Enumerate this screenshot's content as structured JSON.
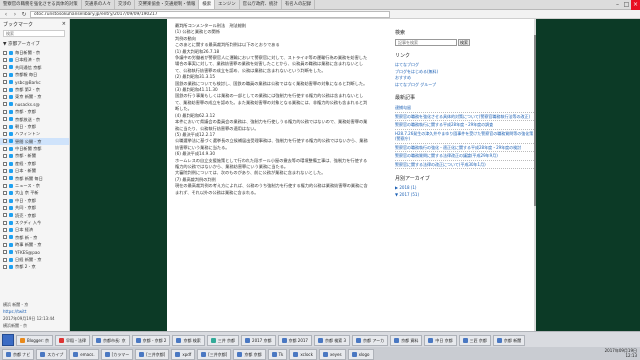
{
  "tabs": [
    {
      "label": "警察官の職務を強化させる具体的対策",
      "active": false
    },
    {
      "label": "交通系の人々",
      "active": false
    },
    {
      "label": "交渉の",
      "active": false
    },
    {
      "label": "交響楽協会・交通規制・情報",
      "active": false
    },
    {
      "label": "検索",
      "active": true
    },
    {
      "label": "エンジン",
      "active": false
    },
    {
      "label": "官公庁政府、統計",
      "active": false
    },
    {
      "label": "有名人の記録",
      "active": false
    }
  ],
  "address_bar": {
    "url": "otoc.runstosokuhanselibary.jp/entry/2017/09/09/190217"
  },
  "sidebar": {
    "title": "ブックマーク",
    "search_placeholder": "検索",
    "folder": "▼ 京都アーカイブ",
    "items": [
      {
        "label": "毎日新聞 - 京",
        "icon": "twitter-icon",
        "selected": false
      },
      {
        "label": "日本経済 - 京",
        "icon": "twitter-icon",
        "selected": false
      },
      {
        "label": "共同通信 京都",
        "icon": "twitter-icon",
        "selected": false
      },
      {
        "label": "京都報 毎日",
        "icon": "twitter-icon",
        "selected": false
      },
      {
        "label": "ysbc@Barkc",
        "icon": "twitter-icon",
        "selected": false
      },
      {
        "label": "京都 第2 - 京",
        "icon": "twitter-icon",
        "selected": false
      },
      {
        "label": "東京 新聞 - 京",
        "icon": "twitter-icon",
        "selected": false
      },
      {
        "label": "nusacks.s@",
        "icon": "twitter-icon",
        "selected": false
      },
      {
        "label": "京都 - 京都",
        "icon": "twitter-icon",
        "selected": false
      },
      {
        "label": "京都放送 - 京",
        "icon": "twitter-icon",
        "selected": false
      },
      {
        "label": "朝日 - 京都",
        "icon": "twitter-icon",
        "selected": false
      },
      {
        "label": "ハフィントン",
        "icon": "twitter-icon",
        "selected": false
      },
      {
        "label": "昼間 公開 - 京",
        "icon": "twitter-icon",
        "selected": true
      },
      {
        "label": "中日新聞 京都",
        "icon": "twitter-icon",
        "selected": false
      },
      {
        "label": "京都 - 新聞",
        "icon": "twitter-icon",
        "selected": false
      },
      {
        "label": "産経 - 京都",
        "icon": "twitter-icon",
        "selected": false
      },
      {
        "label": "日本 - 新聞",
        "icon": "twitter-icon",
        "selected": false
      },
      {
        "label": "京都 新聞 毎日",
        "icon": "twitter-icon",
        "selected": false
      },
      {
        "label": "ニュース - 京",
        "icon": "twitter-icon",
        "selected": false
      },
      {
        "label": "大山 京 平新",
        "icon": "twitter-icon",
        "selected": false
      },
      {
        "label": "中日 - 京都",
        "icon": "twitter-icon",
        "selected": false
      },
      {
        "label": "共同 - 京都",
        "icon": "twitter-icon",
        "selected": false
      },
      {
        "label": "読売 - 京都",
        "icon": "twitter-icon",
        "selected": false
      },
      {
        "label": "スクディ 入今",
        "icon": "twitter-icon",
        "selected": false
      },
      {
        "label": "日本 経済",
        "icon": "twitter-icon",
        "selected": false
      },
      {
        "label": "京都 新 - 京",
        "icon": "twitter-icon",
        "selected": false
      },
      {
        "label": "時事 新聞 - 京",
        "icon": "twitter-icon",
        "selected": false
      },
      {
        "label": "YFKES@pao",
        "icon": "twitter-icon",
        "selected": false
      },
      {
        "label": "日経 新聞 - 京",
        "icon": "twitter-icon",
        "selected": false
      },
      {
        "label": "京都 2 - 京",
        "icon": "twitter-icon",
        "selected": false
      }
    ],
    "footer": {
      "item1": "横浜 新聞 - 京",
      "link": "https://twitt",
      "timestamp": "2017年09月19日 12:13:44",
      "item2": "横浜新聞 - 京"
    }
  },
  "article": {
    "lines": [
      "最判所コンメンタール刑法　刑法総則",
      "(1) 公務と業務との関係",
      "判例の動向",
      "このあとに関する最高裁判所判例は以下のとおりである",
      "(1) 最大判昭和26.7.18",
      "争議中の労働者が警察官人に運輸において警察官に対して、ストライキ等の運輸行為の業務を妨害した場合の事実に対して、業務妨害罪の業務を妨害したことから、公務員の職務は業務に含まれないとして、公務執行妨害罪の成立を認め、公務は業務に含まれないという判断をした。",
      "(2) 最判昭和31.3.15",
      "国鉄の業務についても検討し、国鉄の職員の業務は公務ではなく業務妨害罪の対象になると判断した。",
      "(3) 最判昭和41.11.30",
      "国鉄の行う事業もしくは業務の一部としての業務には強制力を行使する権力的公務は含まれないとして、業務妨害罪の成立を認めた。また業務妨害罪の対象となる業務には、非権力的公務も含まれると判断した。",
      "(4) 最判昭和62.3.12",
      "本件において県議会の委員会の業務は、強制力を行使しうる権力的公務ではないので、業務妨害罪の業務に当たり、公務執行妨害罪の適用はない。",
      "(5) 最決平成12.2.17",
      "公職選挙法に基づく選挙長の立候補届出受理事務は、強制力を行使する権力的公務ではないから、業務妨害罪にいう業務に当たる。",
      "(6) 最決平成14.9.30",
      "ホームレスの自立支援施策として行われた段ボール小屋の撤去等の環境整備工事は、強制力を行使する権力的公務ではないから、業務妨害罪にいう業務に当たる。",
      "大審院判例については、次のものがあり、前に公務が業務に含まれないとした。",
      "(7) 最高裁判例の判例",
      "現在の最高裁判例の考え方によれば、公務のうち強制力を行使する権力的公務は業務妨害罪の業務に含まれず、それ以外の公務は業務に含まれる。"
    ]
  },
  "right_column": {
    "search_title": "検索",
    "search_placeholder": "記事を検索",
    "search_button": "検索",
    "links_title": "リンク",
    "links": [
      "はてなブログ",
      "ブログをはじめる(無料)",
      "おすすめ",
      "はてなブログ グループ"
    ],
    "recent_title": "最新記事",
    "recent": [
      "逮捕勾留",
      "警察官の職務を強化させる具体的対策について(警察官職務執行法等の改正)",
      "警察官の職務執行に関する平成28年度・29年度の調査",
      "H28.7.26発生の津久井やまゆり園事件を受けた警察官の職務質問等の強化策(警察庁)",
      "警察官の職務執行の強化・適正化に関する平成28年度・29年度の検討",
      "警察官の職務質問に関する法律改正の議論(平成29年9月)",
      "警察官に関する法律の改正について(平成30年1月)"
    ],
    "archive_title": "月別アーカイブ",
    "archive": [
      "▶ 2018 (1)",
      "▼ 2017 (51)"
    ]
  },
  "taskbar": {
    "row1": [
      {
        "label": "Blogger: 京",
        "icon": "orange"
      },
      {
        "label": "早稲・法律",
        "icon": "red"
      },
      {
        "label": "京都市長: 京",
        "icon": "blue"
      },
      {
        "label": "京都 - 京都 2",
        "icon": "blue"
      },
      {
        "label": "京都 検索",
        "icon": "blue"
      },
      {
        "label": "三井 京都",
        "icon": "green"
      },
      {
        "label": "2017 京都",
        "icon": "blue"
      },
      {
        "label": "京都 2017",
        "icon": "blue"
      },
      {
        "label": "京都 検索 3",
        "icon": "blue"
      },
      {
        "label": "京都 アーカ",
        "icon": "blue"
      },
      {
        "label": "京都 資料",
        "icon": "blue"
      },
      {
        "label": "中日 京都",
        "icon": "blue"
      },
      {
        "label": "三匠 京都",
        "icon": "blue"
      },
      {
        "label": "京都 新聞",
        "icon": "blue"
      }
    ],
    "row2": [
      {
        "label": "京都 ナビ",
        "icon": "blue"
      },
      {
        "label": "スカイプ",
        "icon": "blue"
      },
      {
        "label": "emacs.",
        "icon": "blue"
      },
      {
        "label": "[カラマー",
        "icon": "blue"
      },
      {
        "label": "[三井京都]",
        "icon": "blue"
      },
      {
        "label": "xpdf",
        "icon": "blue"
      },
      {
        "label": "[三井京都]",
        "icon": "blue"
      },
      {
        "label": "京都 京都",
        "icon": "blue"
      },
      {
        "label": "Tk",
        "icon": "blue"
      },
      {
        "label": "xclock",
        "icon": "blue"
      },
      {
        "label": "xeyes",
        "icon": "blue"
      },
      {
        "label": "xlogo",
        "icon": "blue"
      }
    ],
    "clock_date": "2017年09月19日",
    "clock_time": "12:13"
  },
  "scroll": {
    "thumb_start": 0.05,
    "thumb_fraction": 0.55
  }
}
